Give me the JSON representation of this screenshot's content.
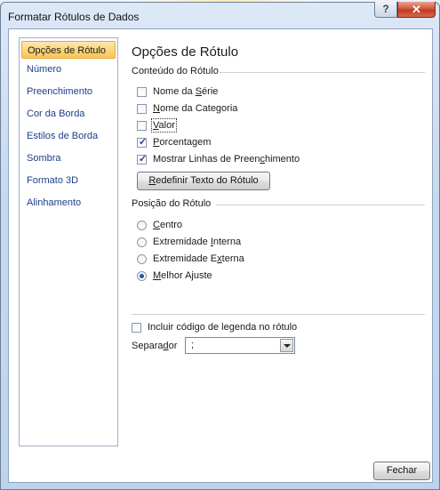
{
  "window": {
    "title": "Formatar Rótulos de Dados",
    "help_label": "?",
    "close_label": "✕"
  },
  "nav": {
    "items": [
      {
        "label": "Opções de Rótulo",
        "selected": true
      },
      {
        "label": "Número"
      },
      {
        "label": "Preenchimento"
      },
      {
        "label": "Cor da Borda"
      },
      {
        "label": "Estilos de Borda"
      },
      {
        "label": "Sombra"
      },
      {
        "label": "Formato 3D"
      },
      {
        "label": "Alinhamento"
      }
    ]
  },
  "panel": {
    "title": "Opções de Rótulo",
    "content_section": "Conteúdo do Rótulo",
    "checkboxes": [
      {
        "pre": "Nome da ",
        "key": "S",
        "post": "érie",
        "checked": false
      },
      {
        "pre": "",
        "key": "N",
        "post": "ome da Categoria",
        "checked": false
      },
      {
        "pre": "",
        "key": "V",
        "post": "alor",
        "checked": false
      },
      {
        "pre": "",
        "key": "P",
        "post": "orcentagem",
        "checked": true
      },
      {
        "pre": "Mostrar Linhas de Preen",
        "key": "c",
        "post": "himento",
        "checked": true
      }
    ],
    "reset_button": {
      "pre": "",
      "key": "R",
      "post": "edefinir Texto do Rótulo"
    },
    "position_section": "Posição do Rótulo",
    "radios": [
      {
        "pre": "",
        "key": "C",
        "post": "entro",
        "selected": false
      },
      {
        "pre": "Extremidade ",
        "key": "I",
        "post": "nterna",
        "selected": false
      },
      {
        "pre": "Extremidade E",
        "key": "x",
        "post": "terna",
        "selected": false
      },
      {
        "pre": "",
        "key": "M",
        "post": "elhor Ajuste",
        "selected": true
      }
    ],
    "legend_key_checkbox": {
      "label": "Incluir código de legenda no rótulo",
      "checked": false
    },
    "separator": {
      "pre": "Separa",
      "key": "d",
      "post": "or",
      "value": ";"
    }
  },
  "footer": {
    "close_button": "Fechar"
  }
}
